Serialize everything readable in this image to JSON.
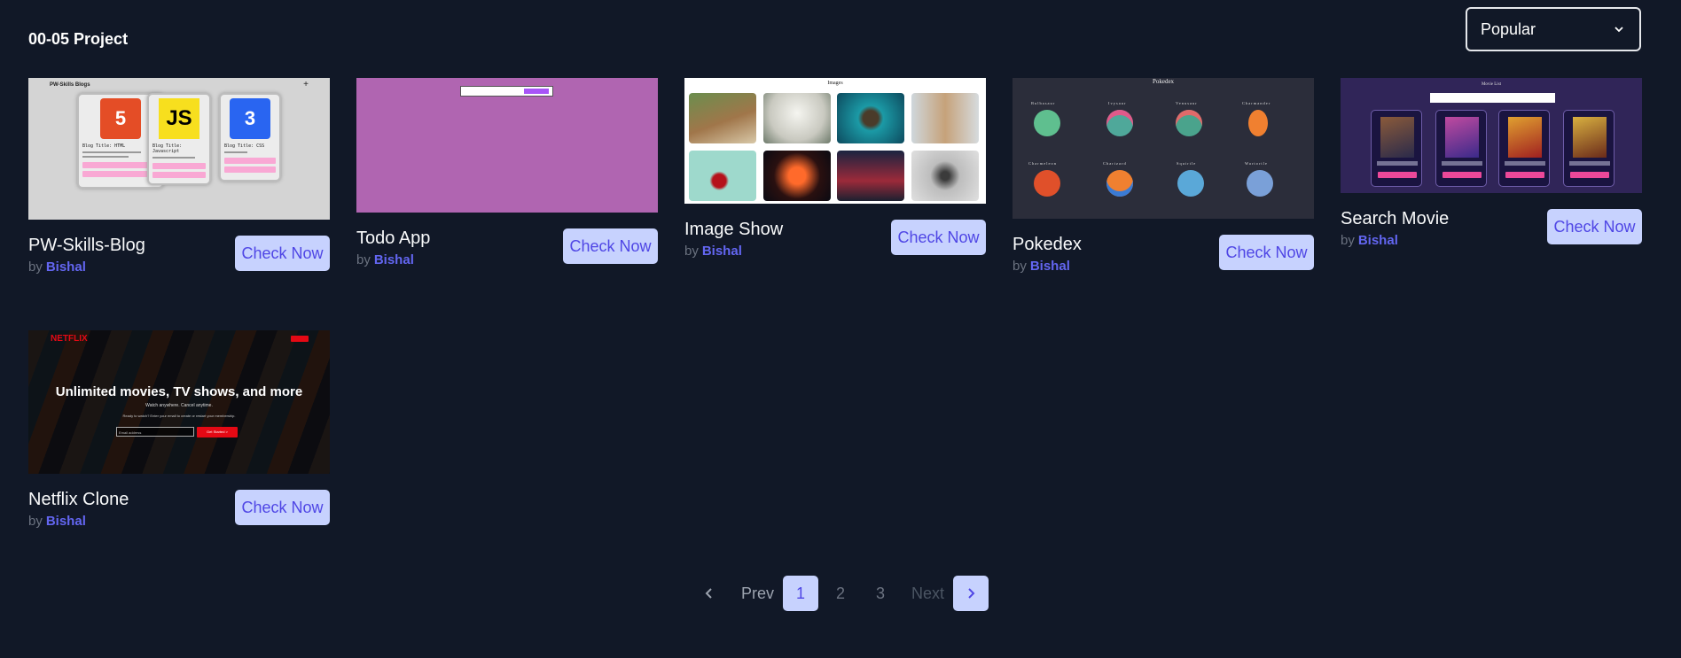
{
  "header": {
    "title": "00-05 Project"
  },
  "sort": {
    "selected": "Popular"
  },
  "projects": [
    {
      "name": "PW-Skills-Blog",
      "by": "by",
      "author": "Bishal",
      "button": "Check Now",
      "preview": {
        "heading": "PW-Skills Blogs",
        "cards": [
          "Blog Title: HTML",
          "Blog Title: Javascript",
          "Blog Title: CSS"
        ],
        "logos": [
          "5",
          "JS",
          "3"
        ]
      }
    },
    {
      "name": "Todo App",
      "by": "by",
      "author": "Bishal",
      "button": "Check Now"
    },
    {
      "name": "Image Show",
      "by": "by",
      "author": "Bishal",
      "button": "Check Now",
      "preview": {
        "heading": "Images"
      }
    },
    {
      "name": "Pokedex",
      "by": "by",
      "author": "Bishal",
      "button": "Check Now",
      "preview": {
        "heading": "Pokedex",
        "pokemon": [
          "Bulbasaur",
          "Ivysaur",
          "Venusaur",
          "Charmander",
          "Charmeleon",
          "Charizard",
          "Squirtle",
          "Wartortle"
        ]
      }
    },
    {
      "name": "Search Movie",
      "by": "by",
      "author": "Bishal",
      "button": "Check Now",
      "preview": {
        "heading": "Movie List"
      }
    },
    {
      "name": "Netflix Clone",
      "by": "by",
      "author": "Bishal",
      "button": "Check Now",
      "preview": {
        "logo": "NETFLIX",
        "sign_in": "Sign In",
        "headline": "Unlimited movies, TV shows, and more",
        "subline": "Watch anywhere. Cancel anytime.",
        "prompt": "Ready to watch? Enter your email to create or restart your membership.",
        "email_placeholder": "Email address",
        "cta": "Get Started >"
      }
    }
  ],
  "pagination": {
    "prev": "Prev",
    "next": "Next",
    "pages": [
      "1",
      "2",
      "3"
    ],
    "current": "1"
  },
  "colors": {
    "background": "#111827",
    "accent": "#c7d2fe",
    "accent_text": "#4f46e5",
    "author": "#6366f1"
  },
  "icons": {
    "sort": "chevron-down-icon",
    "prev": "chevron-left-icon",
    "next": "chevron-right-icon"
  }
}
